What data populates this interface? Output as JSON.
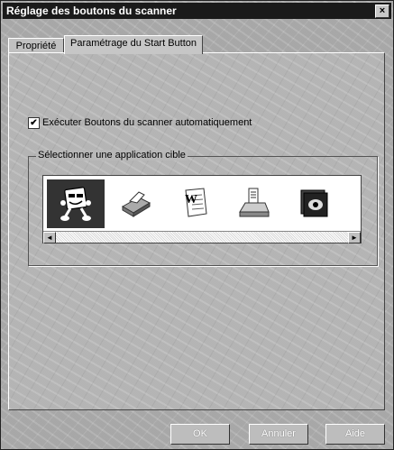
{
  "window": {
    "title": "Réglage des boutons du scanner",
    "close_symbol": "×"
  },
  "tabs": [
    {
      "label": "Propriété",
      "active": false
    },
    {
      "label": "Paramétrage du Start Button",
      "active": true
    }
  ],
  "auto_scan": {
    "label": "Exécuter Boutons du scanner automatiquement",
    "checked": true,
    "check_mark": "✔"
  },
  "target_group": {
    "label": "Sélectionner une application cible",
    "apps": [
      {
        "icon": "scanner-mascot-icon",
        "selected": true
      },
      {
        "icon": "printer-icon",
        "selected": false
      },
      {
        "icon": "word-document-icon",
        "selected": false
      },
      {
        "icon": "fax-machine-icon",
        "selected": false
      },
      {
        "icon": "image-viewer-icon",
        "selected": false
      }
    ],
    "scroll_left_symbol": "◄",
    "scroll_right_symbol": "►"
  },
  "buttons": {
    "ok": "OK",
    "cancel": "Annuler",
    "help": "Aide"
  }
}
